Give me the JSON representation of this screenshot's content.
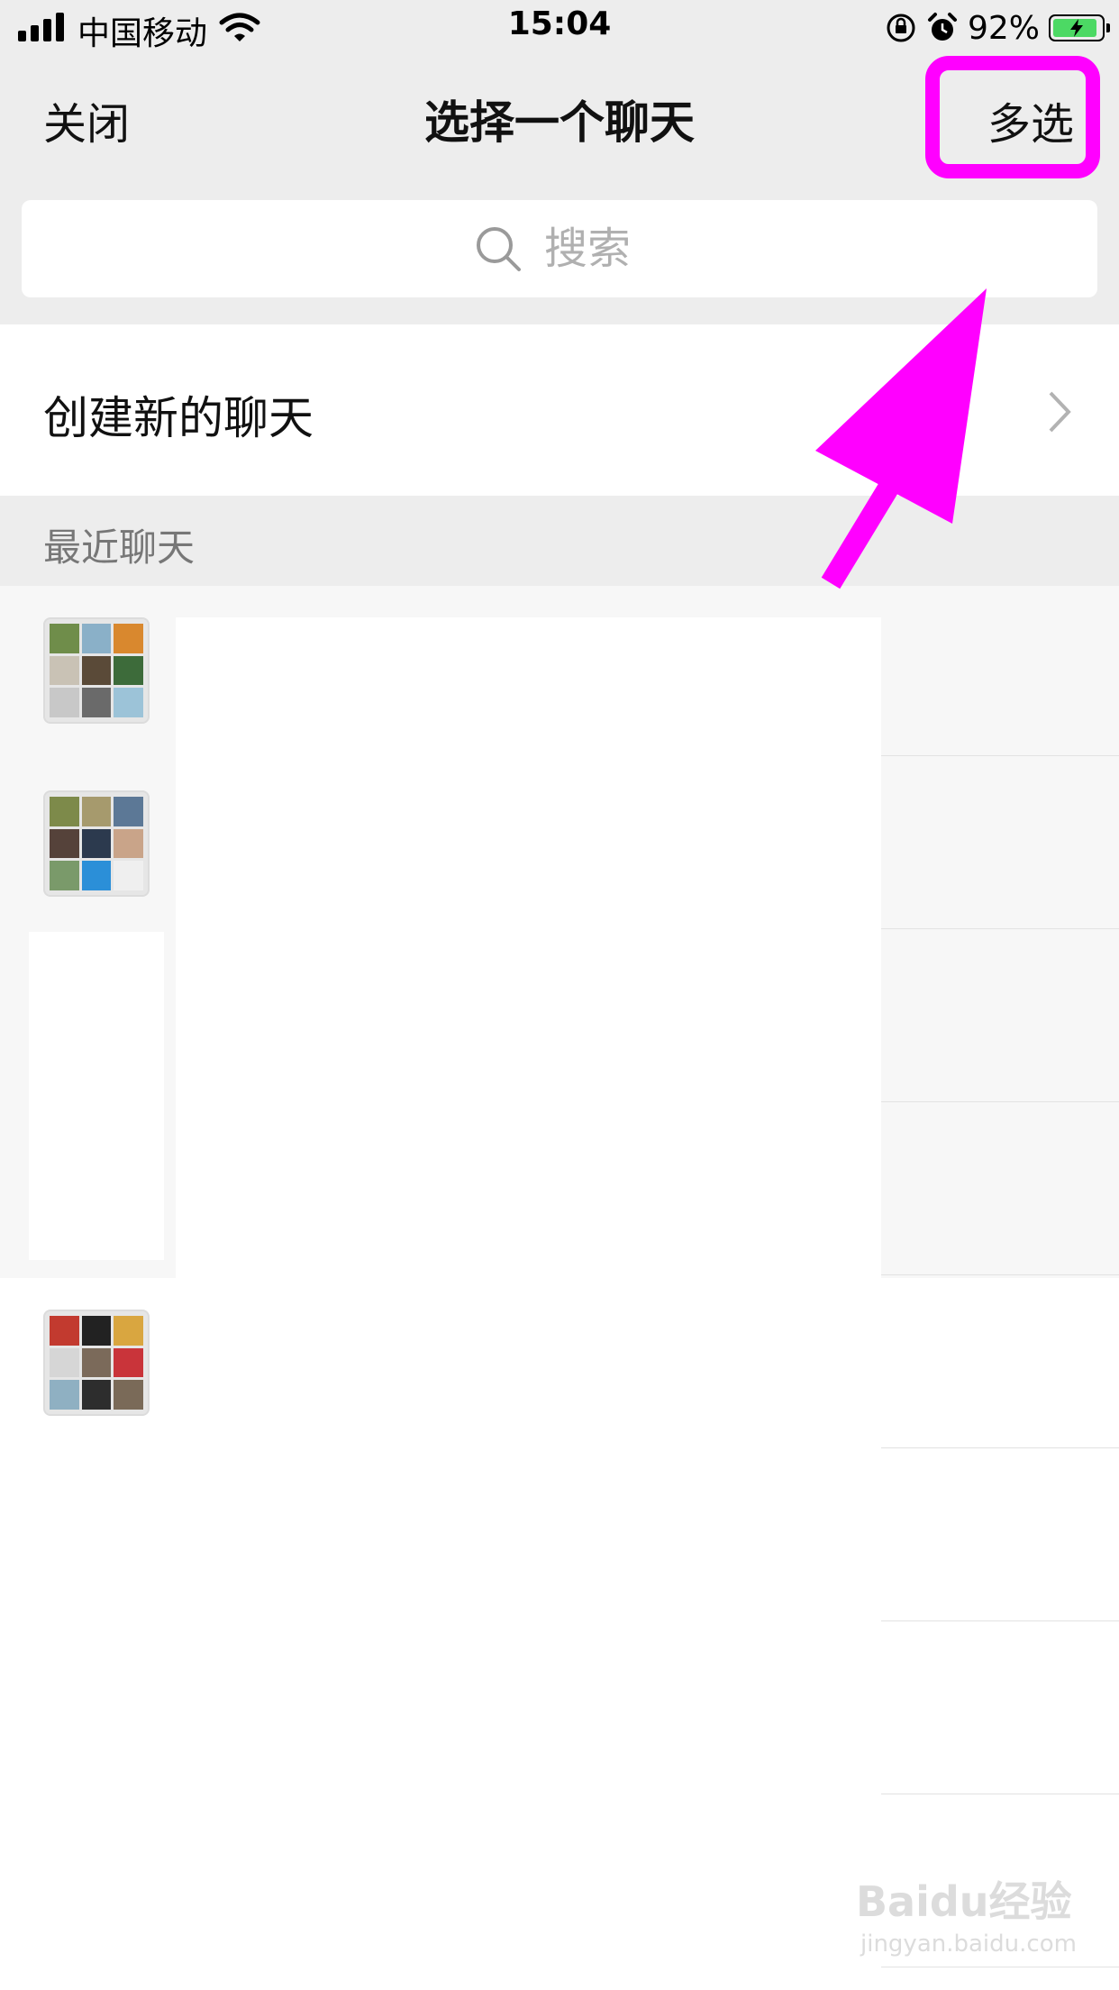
{
  "status_bar": {
    "carrier": "中国移动",
    "time": "15:04",
    "battery": "92%"
  },
  "nav": {
    "close_label": "关闭",
    "title": "选择一个聊天",
    "multi_select_label": "多选"
  },
  "search": {
    "placeholder": "搜索"
  },
  "new_chat": {
    "label": "创建新的聊天"
  },
  "recent": {
    "section_title": "最近聊天"
  },
  "watermark": {
    "brand": "Baidu经验",
    "url": "jingyan.baidu.com"
  },
  "colors": {
    "highlight": "#ff00ff",
    "battery_fill": "#4cd964",
    "header_bg": "#ededed"
  },
  "icons": [
    "signal-icon",
    "wifi-icon",
    "rotation-lock-icon",
    "alarm-icon",
    "battery-icon",
    "search-icon",
    "chevron-right-icon",
    "annotation-arrow"
  ]
}
